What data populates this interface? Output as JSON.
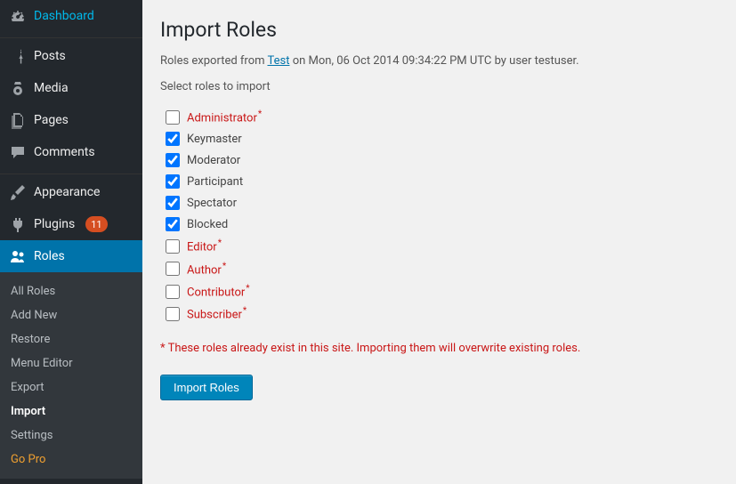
{
  "sidebar": {
    "items": [
      {
        "label": "Dashboard",
        "icon": "dashboard"
      },
      {
        "label": "Posts",
        "icon": "pin"
      },
      {
        "label": "Media",
        "icon": "media"
      },
      {
        "label": "Pages",
        "icon": "page"
      },
      {
        "label": "Comments",
        "icon": "comment"
      },
      {
        "label": "Appearance",
        "icon": "brush"
      },
      {
        "label": "Plugins",
        "icon": "plugin",
        "badge": "11"
      },
      {
        "label": "Roles",
        "icon": "users"
      }
    ],
    "submenu": [
      {
        "label": "All Roles"
      },
      {
        "label": "Add New"
      },
      {
        "label": "Restore"
      },
      {
        "label": "Menu Editor"
      },
      {
        "label": "Export"
      },
      {
        "label": "Import",
        "current": true
      },
      {
        "label": "Settings"
      },
      {
        "label": "Go Pro",
        "pro": true
      }
    ]
  },
  "page": {
    "title": "Import Roles",
    "meta_prefix": "Roles exported from ",
    "meta_link": "Test",
    "meta_suffix": " on Mon, 06 Oct 2014 09:34:22 PM UTC by user testuser.",
    "instruction": "Select roles to import",
    "roles": [
      {
        "label": "Administrator",
        "checked": false,
        "exists": true
      },
      {
        "label": "Keymaster",
        "checked": true,
        "exists": false
      },
      {
        "label": "Moderator",
        "checked": true,
        "exists": false
      },
      {
        "label": "Participant",
        "checked": true,
        "exists": false
      },
      {
        "label": "Spectator",
        "checked": true,
        "exists": false
      },
      {
        "label": "Blocked",
        "checked": true,
        "exists": false
      },
      {
        "label": "Editor",
        "checked": false,
        "exists": true
      },
      {
        "label": "Author",
        "checked": false,
        "exists": true
      },
      {
        "label": "Contributor",
        "checked": false,
        "exists": true
      },
      {
        "label": "Subscriber",
        "checked": false,
        "exists": true
      }
    ],
    "warning": "* These roles already exist in this site. Importing them will overwrite existing roles.",
    "submit_label": "Import Roles"
  }
}
